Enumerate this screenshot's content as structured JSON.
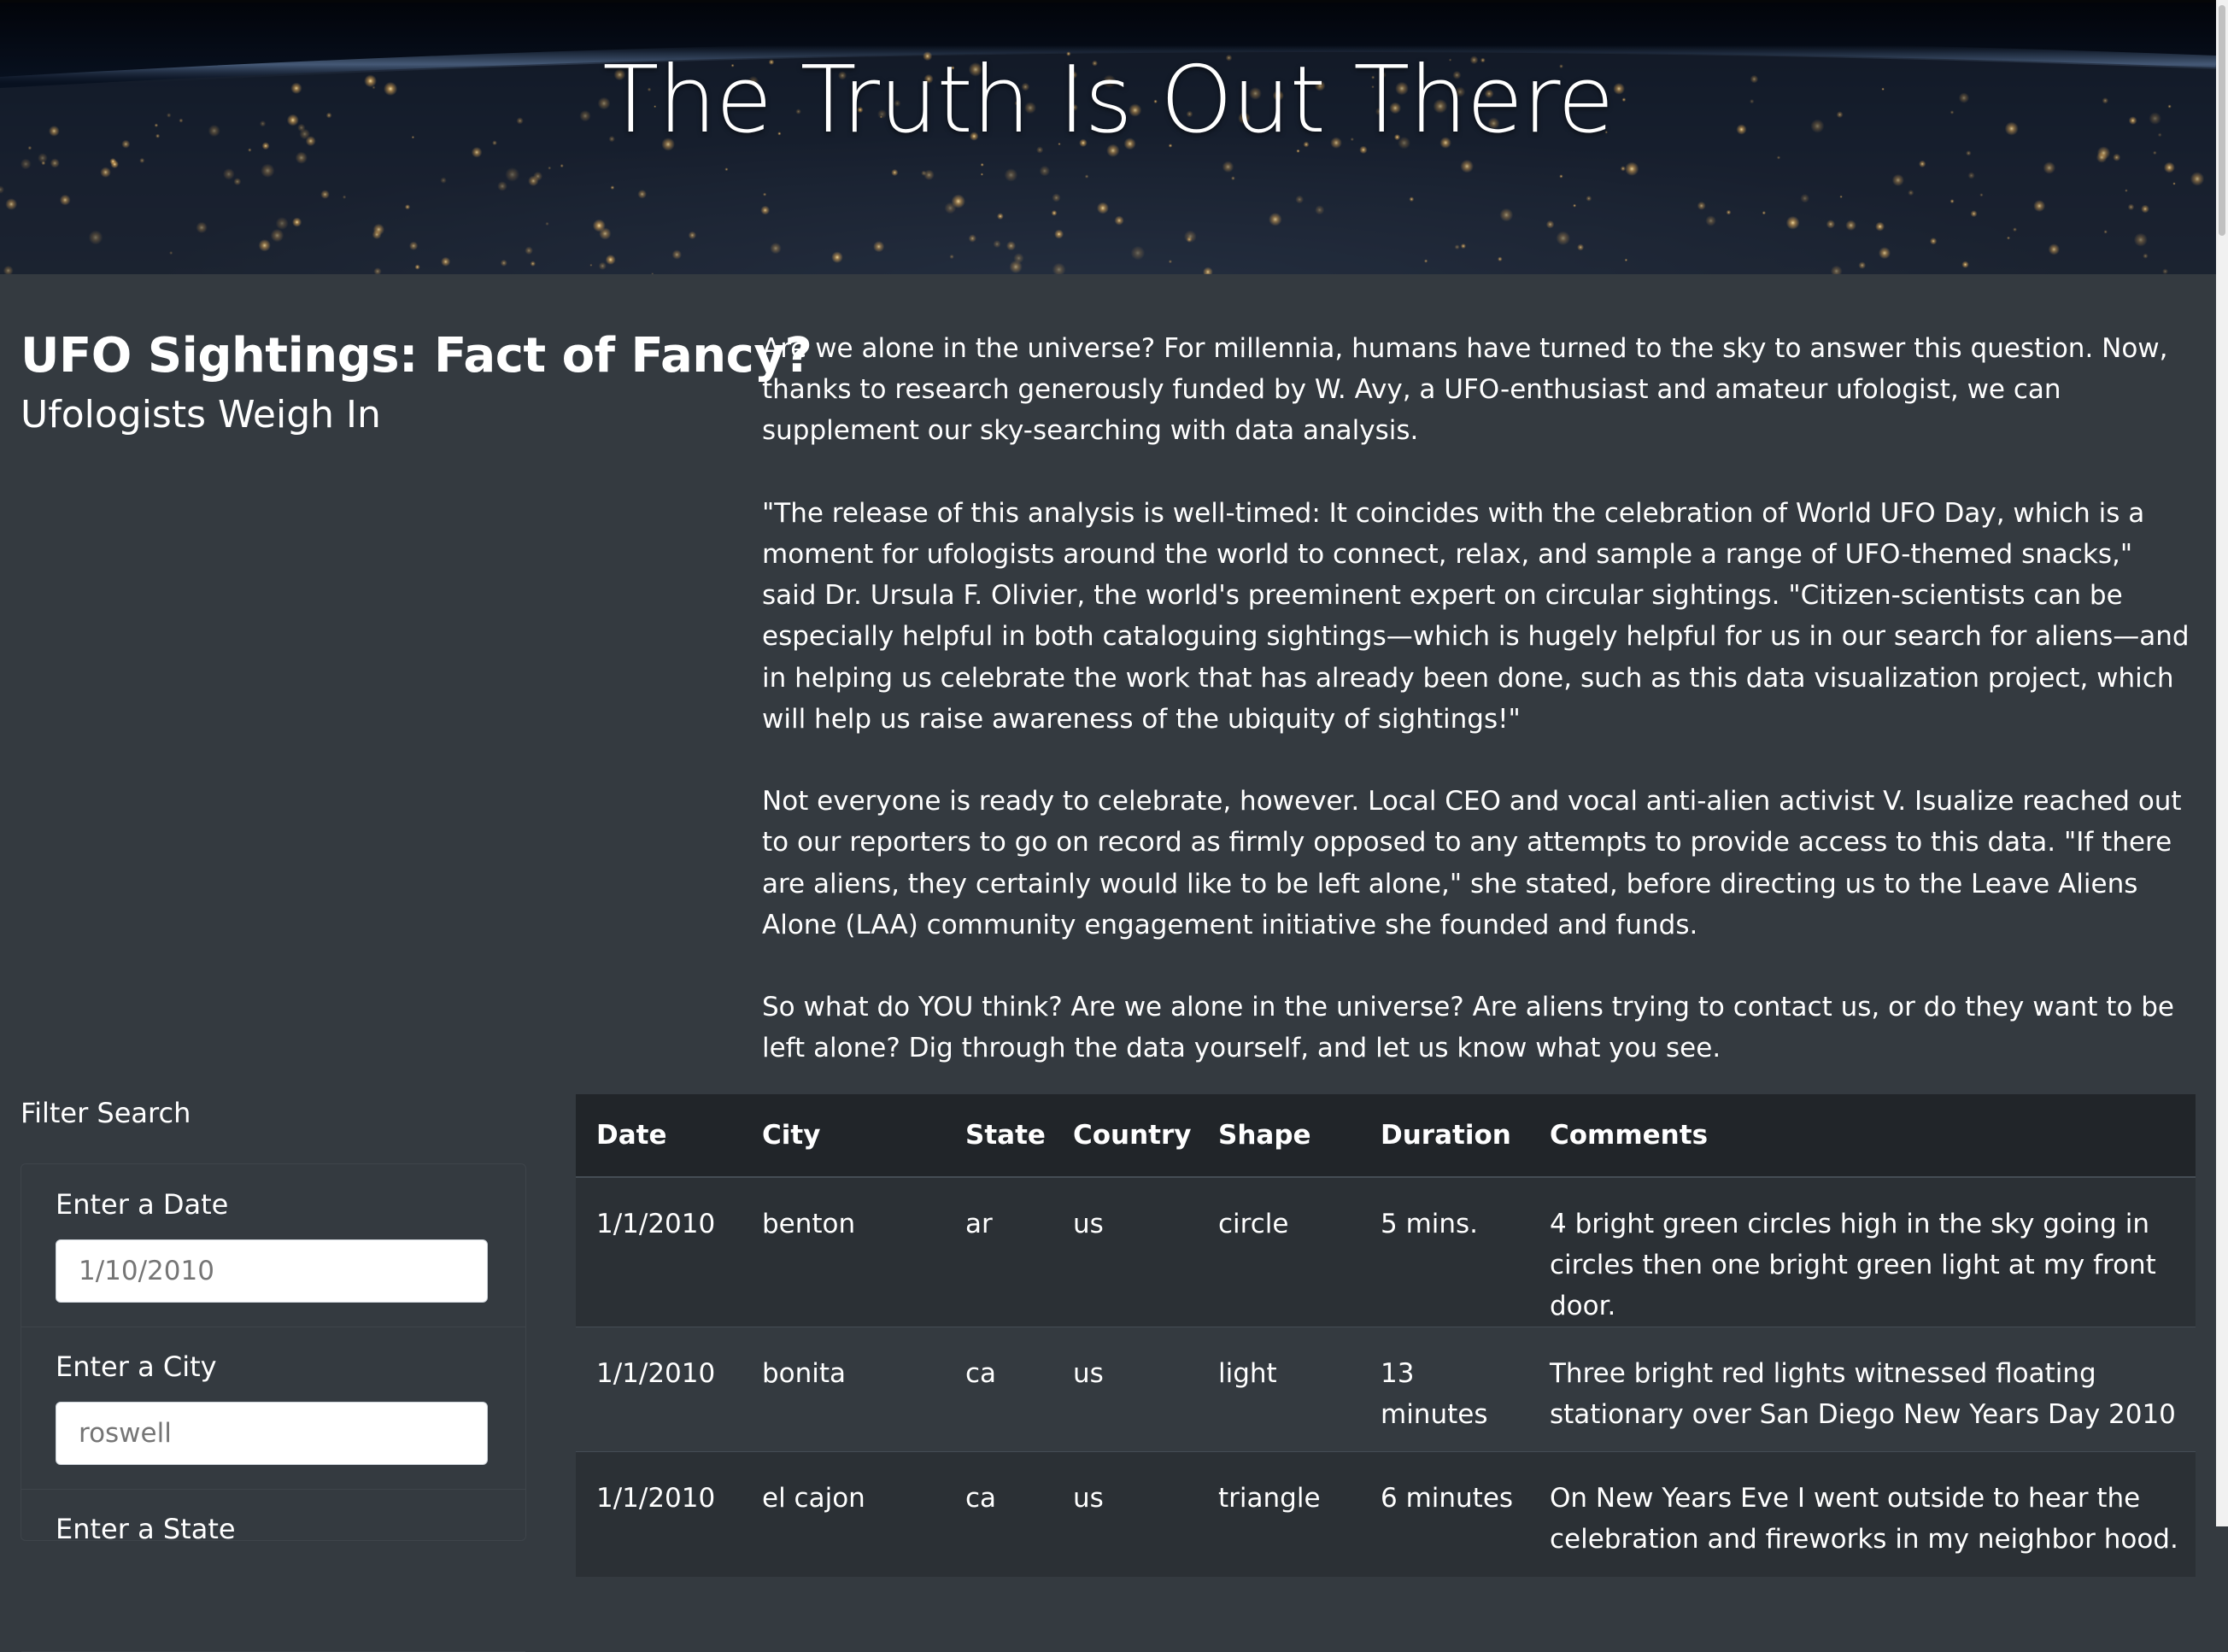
{
  "hero": {
    "title": "The Truth Is Out There"
  },
  "intro": {
    "title": "UFO Sightings: Fact of Fancy?",
    "subtitle": "Ufologists Weigh In"
  },
  "article": {
    "paragraphs": [
      "Are we alone in the universe? For millennia, humans have turned to the sky to answer this question. Now, thanks to research generously funded by W. Avy, a UFO-enthusiast and amateur ufologist, we can supplement our sky-searching with data analysis.",
      "\"The release of this analysis is well-timed: It coincides with the celebration of World UFO Day, which is a moment for ufologists around the world to connect, relax, and sample a range of UFO-themed snacks,\" said Dr. Ursula F. Olivier, the world's preeminent expert on circular sightings. \"Citizen-scientists can be especially helpful in both cataloguing sightings—which is hugely helpful for us in our search for aliens—and in helping us celebrate the work that has already been done, such as this data visualization project, which will help us raise awareness of the ubiquity of sightings!\"",
      "Not everyone is ready to celebrate, however. Local CEO and vocal anti-alien activist V. Isualize reached out to our reporters to go on record as firmly opposed to any attempts to provide access to this data. \"If there are aliens, they certainly would like to be left alone,\" she stated, before directing us to the Leave Aliens Alone (LAA) community engagement initiative she founded and funds.",
      "So what do YOU think? Are we alone in the universe? Are aliens trying to contact us, or do they want to be left alone? Dig through the data yourself, and let us know what you see."
    ]
  },
  "filters": {
    "heading": "Filter Search",
    "items": [
      {
        "label": "Enter a Date",
        "placeholder": "1/10/2010"
      },
      {
        "label": "Enter a City",
        "placeholder": "roswell"
      },
      {
        "label": "Enter a State",
        "placeholder": ""
      }
    ]
  },
  "table": {
    "headers": [
      "Date",
      "City",
      "State",
      "Country",
      "Shape",
      "Duration",
      "Comments"
    ],
    "rows": [
      [
        "1/1/2010",
        "benton",
        "ar",
        "us",
        "circle",
        "5 mins.",
        "4 bright green circles high in the sky going in circles then one bright green light at my front door."
      ],
      [
        "1/1/2010",
        "bonita",
        "ca",
        "us",
        "light",
        "13 minutes",
        "Three bright red lights witnessed floating stationary over San Diego New Years Day 2010"
      ],
      [
        "1/1/2010",
        "el cajon",
        "ca",
        "us",
        "triangle",
        "6 minutes",
        "On New Years Eve I went outside to hear the celebration and fireworks in my neighbor hood."
      ]
    ]
  },
  "colors": {
    "background": "#343a40",
    "table_header": "#212529",
    "row_striped": "#2b3035",
    "text": "#ffffff"
  }
}
